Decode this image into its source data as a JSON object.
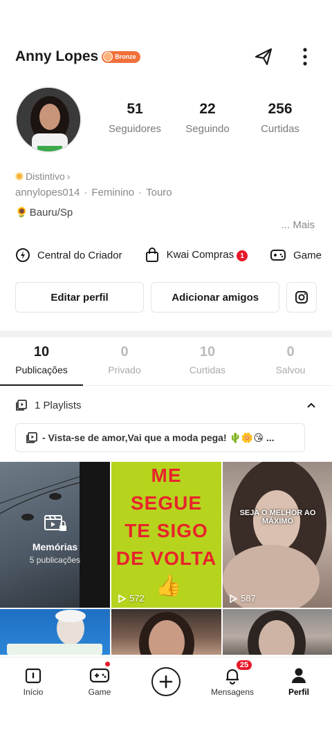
{
  "profile": {
    "name": "Anny Lopes",
    "badge": "Bronze",
    "stats": [
      {
        "value": "51",
        "label": "Seguidores"
      },
      {
        "value": "22",
        "label": "Seguindo"
      },
      {
        "value": "256",
        "label": "Curtidas"
      }
    ],
    "distintivo": "Distintivo",
    "username": "annylopes014",
    "gender": "Feminino",
    "sign": "Touro",
    "city": "Bauru/Sp",
    "more": "... Mais"
  },
  "shortcuts": {
    "creator": "Central do Criador",
    "shop": "Kwai Compras",
    "shop_badge": "1",
    "game": "Game"
  },
  "actions": {
    "edit": "Editar perfil",
    "add_friends": "Adicionar amigos"
  },
  "tabs": [
    {
      "count": "10",
      "label": "Publicações"
    },
    {
      "count": "0",
      "label": "Privado"
    },
    {
      "count": "10",
      "label": "Curtidas"
    },
    {
      "count": "0",
      "label": "Salvou"
    }
  ],
  "playlists": {
    "header": "1 Playlists",
    "item": "- Vista-se de amor,Vai que a moda pega! 🌵🌼😘 ..."
  },
  "grid": {
    "memories_title": "Memórias",
    "memories_sub": "5 publicações",
    "green_text": [
      "ME",
      "SEGUE",
      "TE SIGO",
      "DE VOLTA"
    ],
    "green_views": "572",
    "girl_overlay": "SEJA O MELHOR AO MÁXIMO",
    "girl_views": "587"
  },
  "nav": {
    "home": "Início",
    "game": "Game",
    "messages": "Mensagens",
    "messages_badge": "25",
    "profile": "Perfil"
  },
  "colors": {
    "accent_red": "#e8192c",
    "badge_orange": "#f0703a",
    "green_tile": "#b6d31e"
  }
}
